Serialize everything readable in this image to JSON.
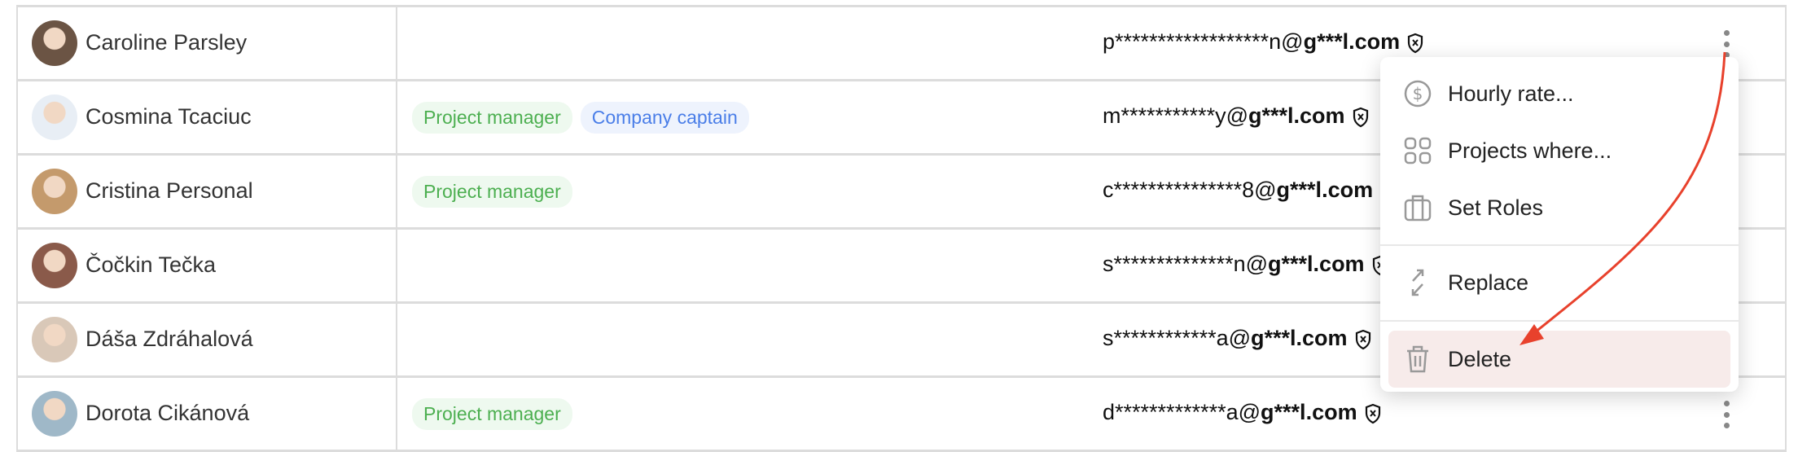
{
  "rows": [
    {
      "name": "Caroline Parsley",
      "tags": [],
      "email_masked": "p******************n@",
      "email_domain": "g***l.com",
      "avatar_color": "#6b5444"
    },
    {
      "name": "Cosmina Tcaciuc",
      "tags": [
        {
          "label": "Project manager",
          "style": "green"
        },
        {
          "label": "Company captain",
          "style": "blue"
        }
      ],
      "email_masked": "m***********y@",
      "email_domain": "g***l.com",
      "avatar_color": "#e8eef5"
    },
    {
      "name": "Cristina Personal",
      "tags": [
        {
          "label": "Project manager",
          "style": "green"
        }
      ],
      "email_masked": "c***************8@",
      "email_domain": "g***l.com",
      "avatar_color": "#c49a6c"
    },
    {
      "name": "Čočkin Tečka",
      "tags": [],
      "email_masked": "s**************n@",
      "email_domain": "g***l.com",
      "avatar_color": "#8a5a4a"
    },
    {
      "name": "Dáša Zdráhalová",
      "tags": [],
      "email_masked": "s************a@",
      "email_domain": "g***l.com",
      "avatar_color": "#d9c8b8"
    },
    {
      "name": "Dorota Cikánová",
      "tags": [
        {
          "label": "Project manager",
          "style": "green"
        }
      ],
      "email_masked": "d*************a@",
      "email_domain": "g***l.com",
      "avatar_color": "#9fb8c8"
    }
  ],
  "menu": {
    "items": [
      {
        "label": "Hourly rate...",
        "icon": "dollar-circle-icon"
      },
      {
        "label": "Projects where...",
        "icon": "grid-icon"
      },
      {
        "label": "Set Roles",
        "icon": "briefcase-icon"
      },
      {
        "label": "Replace",
        "icon": "swap-arrows-icon"
      },
      {
        "label": "Delete",
        "icon": "trash-icon"
      }
    ]
  },
  "colors": {
    "tag_green": "#4caf50",
    "tag_blue": "#4a7ee8",
    "delete_highlight": "#f7ebea",
    "annotation_arrow": "#e8412c"
  }
}
